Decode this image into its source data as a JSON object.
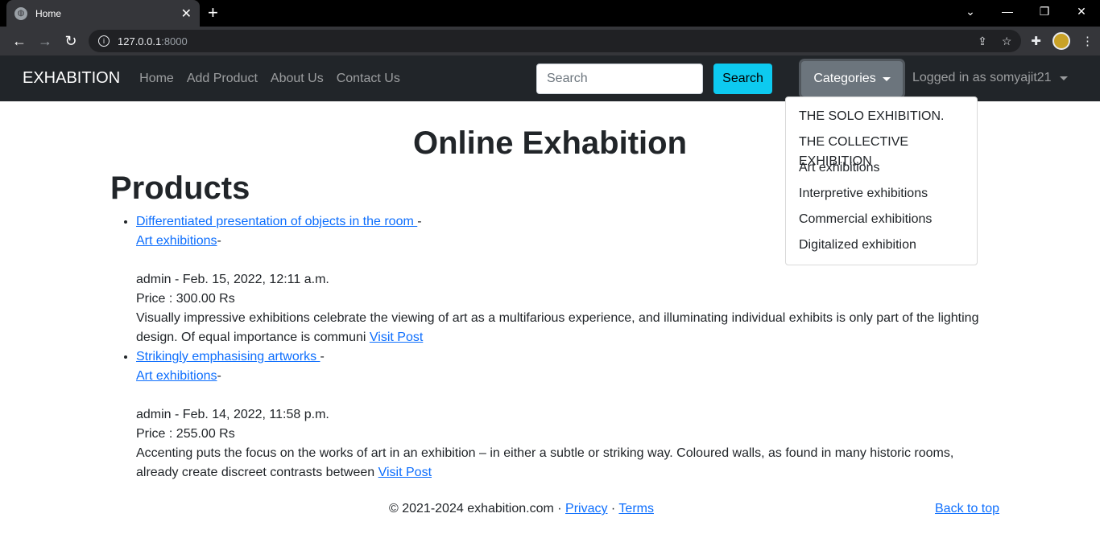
{
  "browser": {
    "tab_title": "Home",
    "url_host": "127.0.0.1",
    "url_port": ":8000"
  },
  "navbar": {
    "brand": "EXHABITION",
    "links": [
      "Home",
      "Add Product",
      "About Us",
      "Contact Us"
    ],
    "search_placeholder": "Search",
    "search_button": "Search",
    "categories_button": "Categories",
    "logged_in": "Logged in as somyajit21"
  },
  "categories": [
    "THE SOLO EXHIBITION.",
    "THE COLLECTIVE EXHIBITION",
    "Art exhibitions",
    "Interpretive exhibitions",
    "Commercial exhibitions",
    "Digitalized exhibition"
  ],
  "page": {
    "title": "Online Exhabition",
    "section": "Products"
  },
  "products": [
    {
      "title": "Differentiated presentation of objects in the room ",
      "category": "Art exhibitions",
      "meta": "admin - Feb. 15, 2022, 12:11 a.m.",
      "price": "Price : 300.00 Rs",
      "excerpt": "Visually impressive exhibitions celebrate the viewing of art as a multifarious experience, and illuminating individual exhibits is only part of the lighting design. Of equal importance is communi ",
      "link": "Visit Post"
    },
    {
      "title": "Strikingly emphasising artworks ",
      "category": "Art exhibitions",
      "meta": "admin - Feb. 14, 2022, 11:58 p.m.",
      "price": "Price : 255.00 Rs",
      "excerpt": "Accenting puts the focus on the works of art in an exhibition – in either a subtle or striking way. Coloured walls, as found in many historic rooms, already create discreet contrasts between ",
      "link": "Visit Post"
    }
  ],
  "footer": {
    "copyright": "© 2021-2024 exhabition.com · ",
    "privacy": "Privacy",
    "sep": " · ",
    "terms": "Terms",
    "back_to_top": "Back to top"
  }
}
